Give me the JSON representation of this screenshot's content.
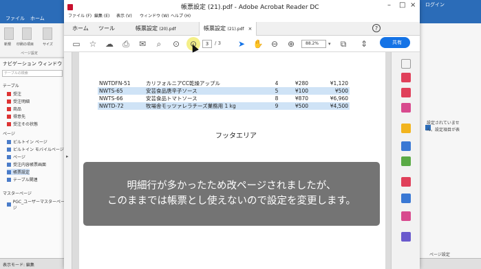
{
  "background_app": {
    "tabs": [
      "ファイル",
      "ホーム"
    ],
    "ribbon_buttons": [
      "新規",
      "印刷の項目",
      "サイズ"
    ],
    "ribbon_group": "ページ設定",
    "nav_title": "ナビゲーション ウィンドウ",
    "nav_search": "テーブルの検索",
    "nav_sections": [
      "テーブル",
      "ページ",
      "マスターページ"
    ],
    "nav_tables": [
      "受注",
      "受注明細",
      "商品",
      "得意先",
      "受注その状態"
    ],
    "nav_pages": [
      "ビルトイン ページ",
      "ビルトイン モバイルページ",
      "ページ",
      "受注内容帳票画面",
      "帳票設定",
      "テーブル関連"
    ],
    "nav_master": [
      "PGC_ユーザーマスターページ"
    ],
    "status": "表示モード: 編集",
    "right_login": "ログイン",
    "right_texts": [
      "設定されていませ",
      "ん。設定項目が表",
      "ページ設定"
    ]
  },
  "acrobat": {
    "window_title": "帳票設定 (21).pdf - Adobe Acrobat Reader DC",
    "menu": [
      "ファイル (F)",
      "編集 (E)",
      "表示 (V)",
      "ウィンドウ (W)",
      "ヘルプ (H)"
    ],
    "tabs": [
      {
        "label": "ホーム"
      },
      {
        "label": "ツール"
      },
      {
        "label": "帳票設定",
        "suffix": "(20).pdf"
      },
      {
        "label": "帳票設定",
        "suffix": "(21).pdf"
      }
    ],
    "close_glyph": "×",
    "help_glyph": "?",
    "toolbar": {
      "current_page": "3",
      "total_pages": "/ 3",
      "zoom": "88.2%",
      "share_label": "共有"
    }
  },
  "document": {
    "rows": [
      {
        "code": "NWTDFN-51",
        "name": "カリフォルニアCC乾燥アップル",
        "qty": "4",
        "price": "¥280",
        "amount": "¥1,120",
        "shaded": false
      },
      {
        "code": "NWTS-65",
        "name": "安芸食品唐辛子ソース",
        "qty": "5",
        "price": "¥100",
        "amount": "¥500",
        "shaded": true
      },
      {
        "code": "NWTS-66",
        "name": "安芸食品トマトソース",
        "qty": "8",
        "price": "¥870",
        "amount": "¥6,960",
        "shaded": false
      },
      {
        "code": "NWTD-72",
        "name": "牧場舎モッツァレラチーズ業務用 1 kg",
        "qty": "9",
        "price": "¥500",
        "amount": "¥4,500",
        "shaded": true
      }
    ],
    "footer_label": "フッタエリア"
  },
  "caption": {
    "line1": "明細行が多かったため改ページされましたが、",
    "line2": "このままでは帳票とし使えないので設定を変更します。"
  }
}
